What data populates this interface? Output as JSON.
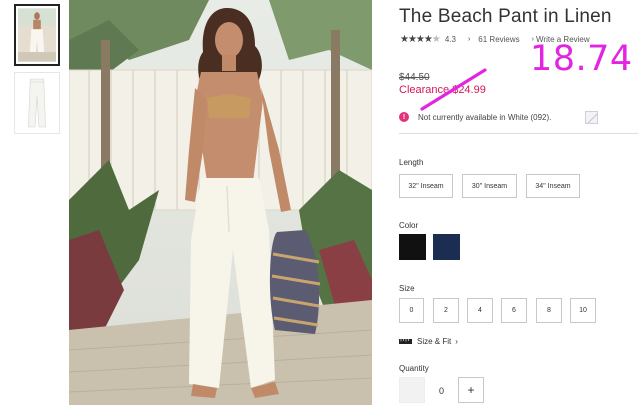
{
  "product": {
    "title": "The Beach Pant in Linen",
    "rating": "4.3",
    "reviews_link": "61 Reviews",
    "write_review": "Write a Review",
    "original_price": "$44.50",
    "clearance_price": "Clearance $24.99",
    "availability": "Not currently available in White (092)."
  },
  "overlay": {
    "price_annotation": "18.74"
  },
  "options": {
    "length_label": "Length",
    "lengths": [
      "32\" Inseam",
      "30\" Inseam",
      "34\" Inseam"
    ],
    "color_label": "Color",
    "colors": [
      "#111111",
      "#1c2d52"
    ],
    "size_label": "Size",
    "sizes": [
      "0",
      "2",
      "4",
      "6",
      "8",
      "10"
    ],
    "size_fit": "Size & Fit",
    "quantity_label": "Quantity",
    "quantity_value": "0",
    "increment": "+"
  },
  "icons": {
    "star": "star-icon",
    "chevron": "chevron-right-icon",
    "alert": "alert-icon",
    "ruler": "ruler-icon"
  },
  "colors": {
    "clearance": "#d31956",
    "annotation": "#e324e2",
    "alert": "#e3317a"
  }
}
